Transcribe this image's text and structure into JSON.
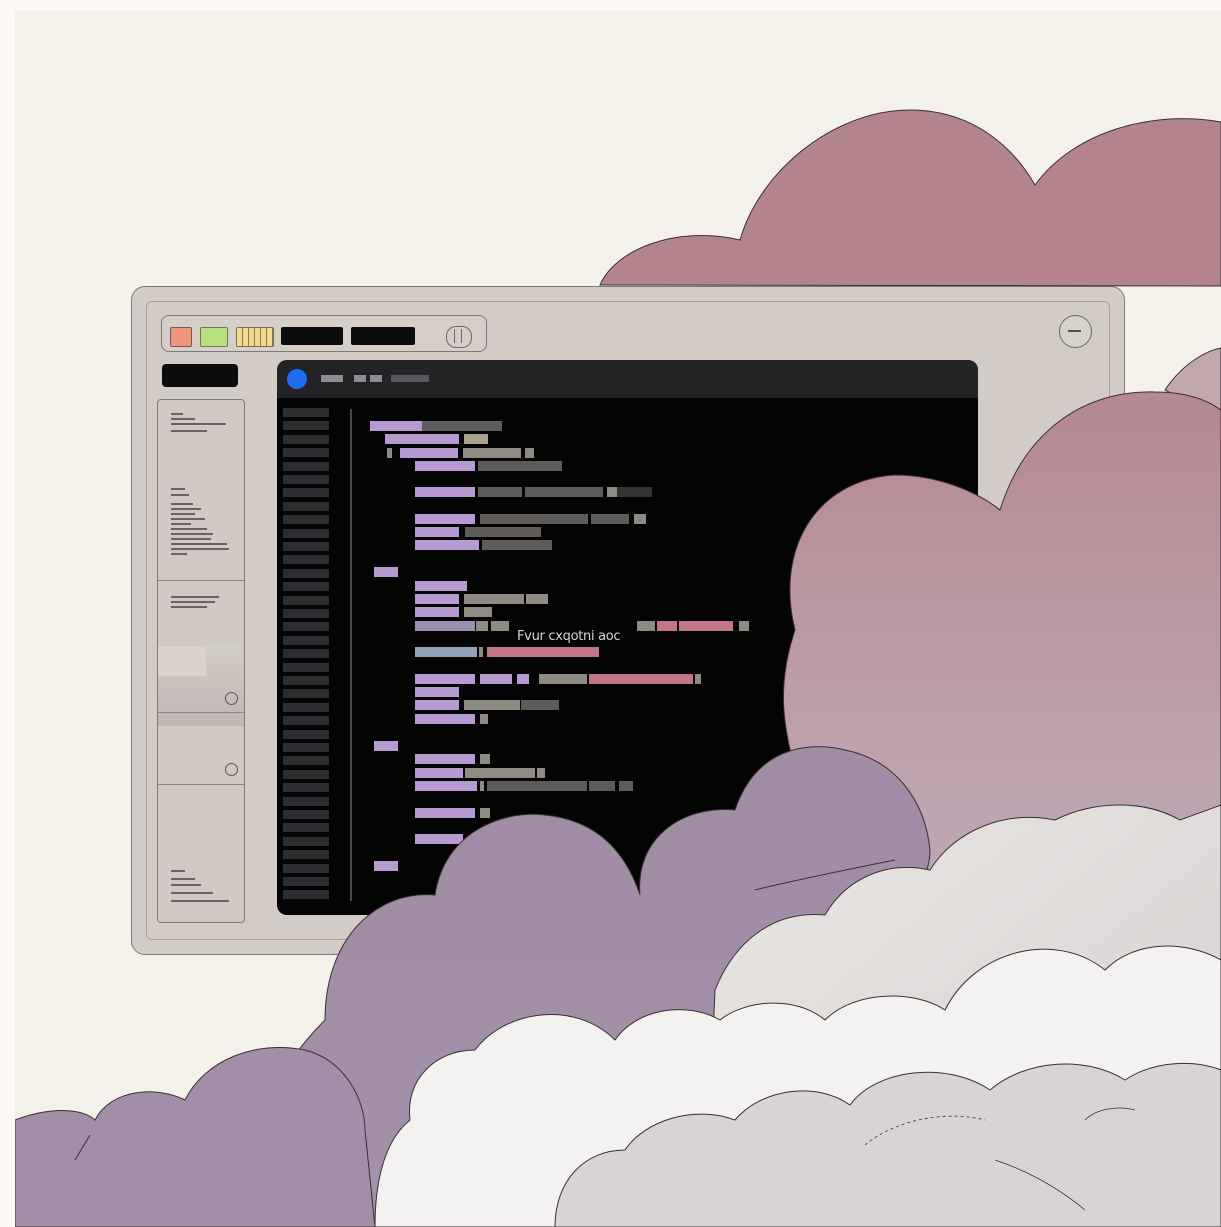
{
  "scene": {
    "type": "illustration",
    "description_colors": {
      "background": "#f4f1ea",
      "window_frame": "#d2cbc6",
      "editor_bg": "#040405",
      "cloud_rose": "#b3848c",
      "cloud_lilac": "#a28ea8",
      "cloud_grey": "#d9d6d5"
    }
  },
  "window": {
    "toolbar": {
      "buttons": [
        {
          "icon": "red-square-icon",
          "color": "#f09577"
        },
        {
          "icon": "green-square-icon",
          "color": "#b8e07f"
        },
        {
          "icon": "yellow-striped-icon",
          "color": "#f1d98f"
        }
      ],
      "toggle_icon": "pill-toggle-icon"
    },
    "minimize_icon": "minus-circle-icon",
    "editor": {
      "accent": "#1f6cf2",
      "highlight_text": "Fvur cxqotni aoc"
    }
  }
}
